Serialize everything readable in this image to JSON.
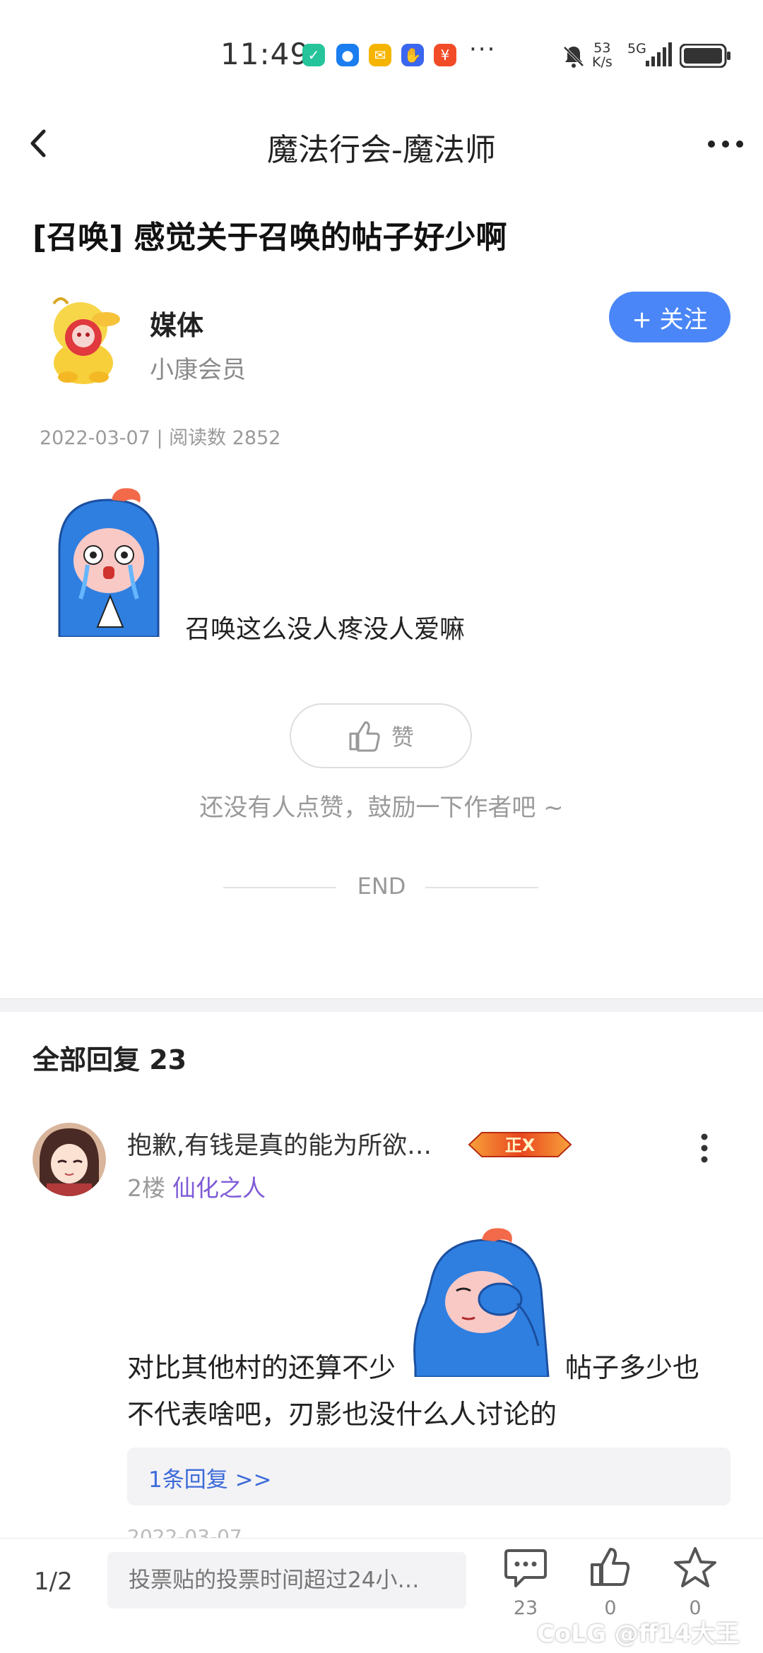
{
  "status_bar": {
    "time": "11:49",
    "more": "···",
    "net_speed_value": "53",
    "net_speed_unit": "K/s",
    "network": "5G",
    "app_icons": [
      "shield-app-icon",
      "assistant-app-icon",
      "mail-app-icon",
      "hand-app-icon",
      "red-packet-app-icon"
    ]
  },
  "nav": {
    "title": "魔法行会-魔法师"
  },
  "post": {
    "title": "[召唤] 感觉关于召唤的帖子好少啊",
    "author_name": "媒体",
    "author_rank": "小康会员",
    "follow_label": "+ 关注",
    "meta": "2022-03-07 | 阅读数 2852",
    "body_text": "召唤这么没人疼没人爱嘛",
    "like_label": "赞",
    "like_hint": "还没有人点赞，鼓励一下作者吧 ~",
    "end_label": "END"
  },
  "replies": {
    "header": "全部回复  23",
    "items": [
      {
        "title": "抱歉,有钱是真的能为所欲…",
        "badge": "正X",
        "floor": "2楼",
        "user": "仙化之人",
        "text_part1": "对比其他村的还算不少",
        "text_part2": "帖子多少也",
        "text_line2": "不代表啥吧，刃影也没什么人讨论的",
        "sub_reply_link": "1条回复 >>",
        "partial_meta": "2022-03-07"
      }
    ]
  },
  "bottom_bar": {
    "page": "1/2",
    "input_placeholder": "投票贴的投票时间超过24小…",
    "comment_count": "23",
    "like_count": "0",
    "favorite_count": "0",
    "watermark": "CoLG @ff14大王"
  },
  "colors": {
    "accent": "#4a86f7",
    "username": "#7e5bd6",
    "link": "#3c6ad9"
  }
}
